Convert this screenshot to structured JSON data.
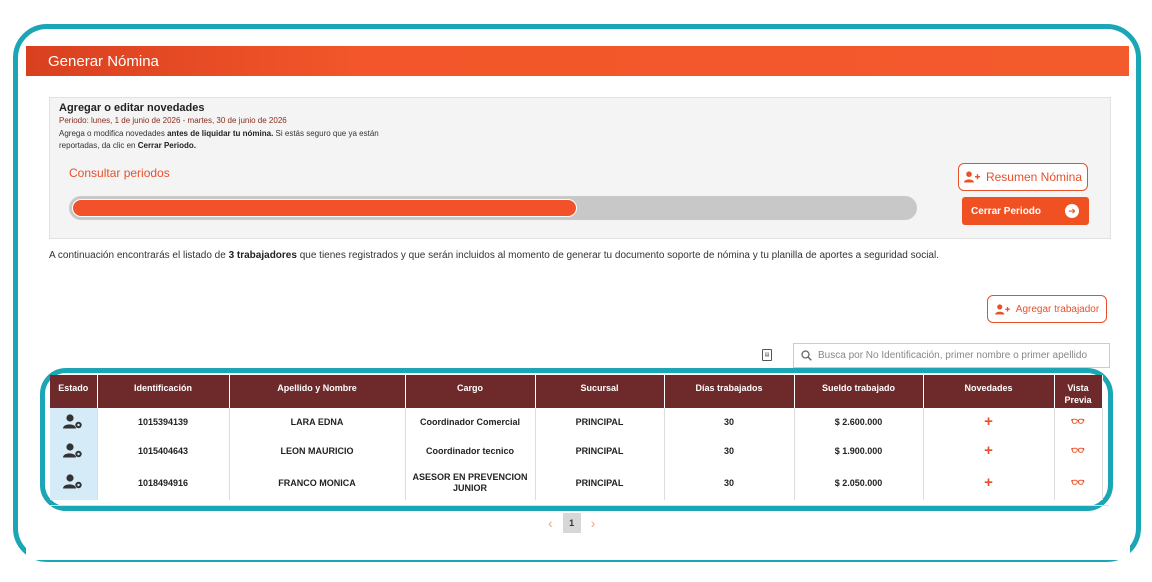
{
  "header": {
    "title": "Generar Nómina"
  },
  "novedades": {
    "title": "Agregar o editar novedades",
    "period": "Periodo: lunes, 1 de junio de 2026 - martes, 30 de junio de 2026",
    "desc_1": "Agrega o modifica novedades ",
    "desc_bold_1": "antes de liquidar tu nómina.",
    "desc_2": " Si estás seguro que ya están reportadas, da clic en ",
    "desc_bold_2": "Cerrar Periodo.",
    "consult_link": "Consultar periodos",
    "progress_percent": 60,
    "resumen_label": "Resumen Nómina",
    "cerrar_label": "Cerrar Periodo"
  },
  "intro": {
    "part_1": "A continuación encontrarás el listado de ",
    "bold": "3 trabajadores",
    "part_2": " que tienes registrados y que serán incluidos al momento de generar tu documento soporte de nómina y tu planilla de aportes a seguridad social."
  },
  "actions": {
    "agregar_label": "Agregar trabajador"
  },
  "search": {
    "placeholder": "Busca por No Identificación, primer nombre o primer apellido"
  },
  "table": {
    "columns": [
      "Estado",
      "Identificación",
      "Apellido y Nombre",
      "Cargo",
      "Sucursal",
      "Días trabajados",
      "Sueldo trabajado",
      "Novedades",
      "Vista Previa"
    ],
    "rows": [
      {
        "id": "1015394139",
        "name": "LARA EDNA",
        "cargo": "Coordinador Comercial",
        "sucursal": "PRINCIPAL",
        "dias": "30",
        "sueldo": "$ 2.600.000"
      },
      {
        "id": "1015404643",
        "name": "LEON MAURICIO",
        "cargo": "Coordinador tecnico",
        "sucursal": "PRINCIPAL",
        "dias": "30",
        "sueldo": "$ 1.900.000"
      },
      {
        "id": "1018494916",
        "name": "FRANCO MONICA",
        "cargo": "ASESOR EN PREVENCION JUNIOR",
        "sucursal": "PRINCIPAL",
        "dias": "30",
        "sueldo": "$ 2.050.000"
      }
    ]
  },
  "pagination": {
    "current": "1"
  },
  "colors": {
    "accent": "#f05123",
    "header_dark": "#6e2a2b",
    "highlight": "#1aa6b4"
  }
}
